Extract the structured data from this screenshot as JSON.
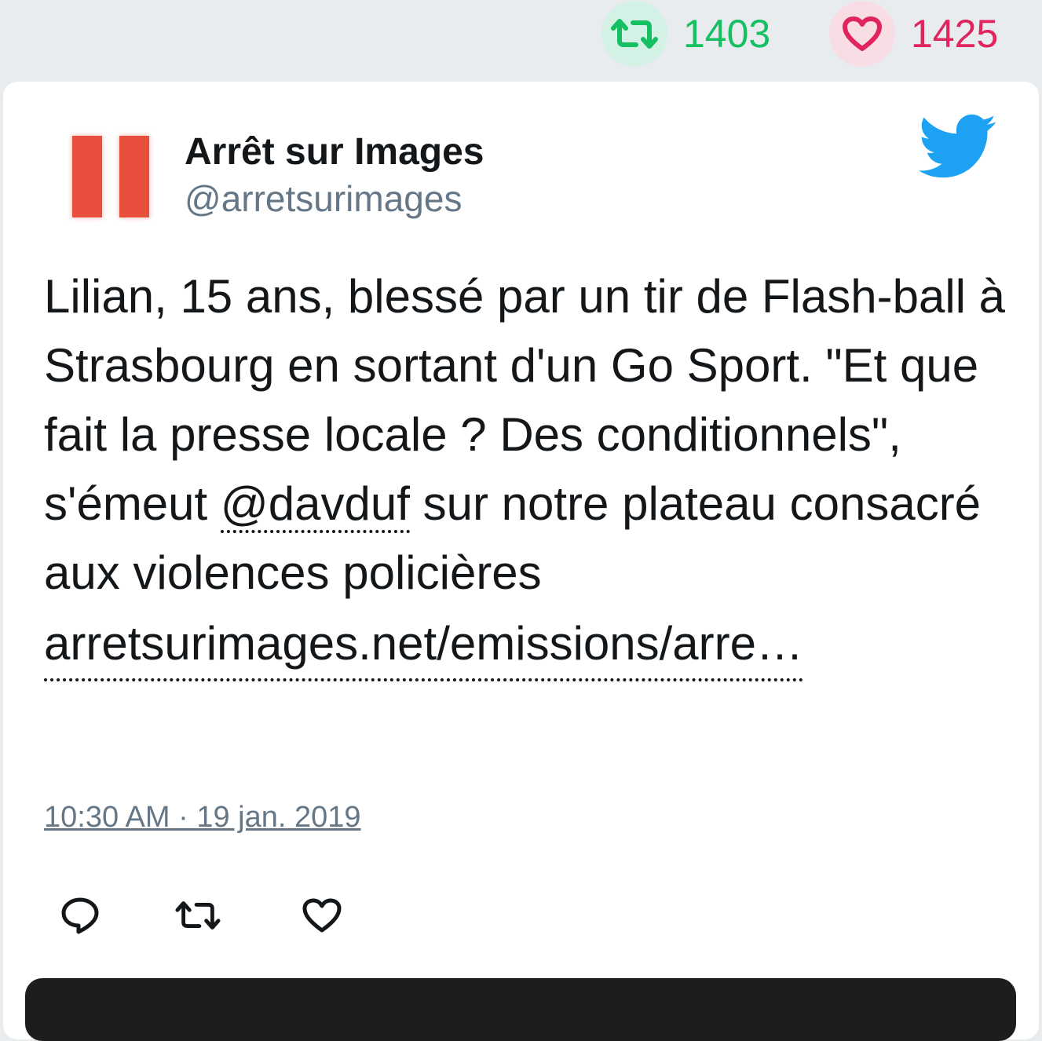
{
  "stats": {
    "retweet_count": "1403",
    "like_count": "1425"
  },
  "tweet": {
    "author_name": "Arrêt sur Images",
    "author_handle": "@arretsurimages",
    "text_part1": "Lilian, 15 ans, blessé par un tir de Flash-ball à Strasbourg en sortant d'un Go Sport. \"Et que fait la presse locale ? Des conditionnels\", s'émeut ",
    "mention": "@davduf",
    "text_part2": " sur notre plateau consacré aux violences policières ",
    "link": "arretsurimages.net/emissions/arre…",
    "timestamp": "10:30 AM · 19 jan. 2019"
  },
  "icons": {
    "retweet": "retweet-icon",
    "like": "heart-icon",
    "twitter": "twitter-bird-icon",
    "reply": "reply-icon"
  },
  "colors": {
    "retweet_green": "#17bf63",
    "like_red": "#e0245e",
    "twitter_blue": "#1da1f2",
    "avatar_red": "#e8503d"
  }
}
